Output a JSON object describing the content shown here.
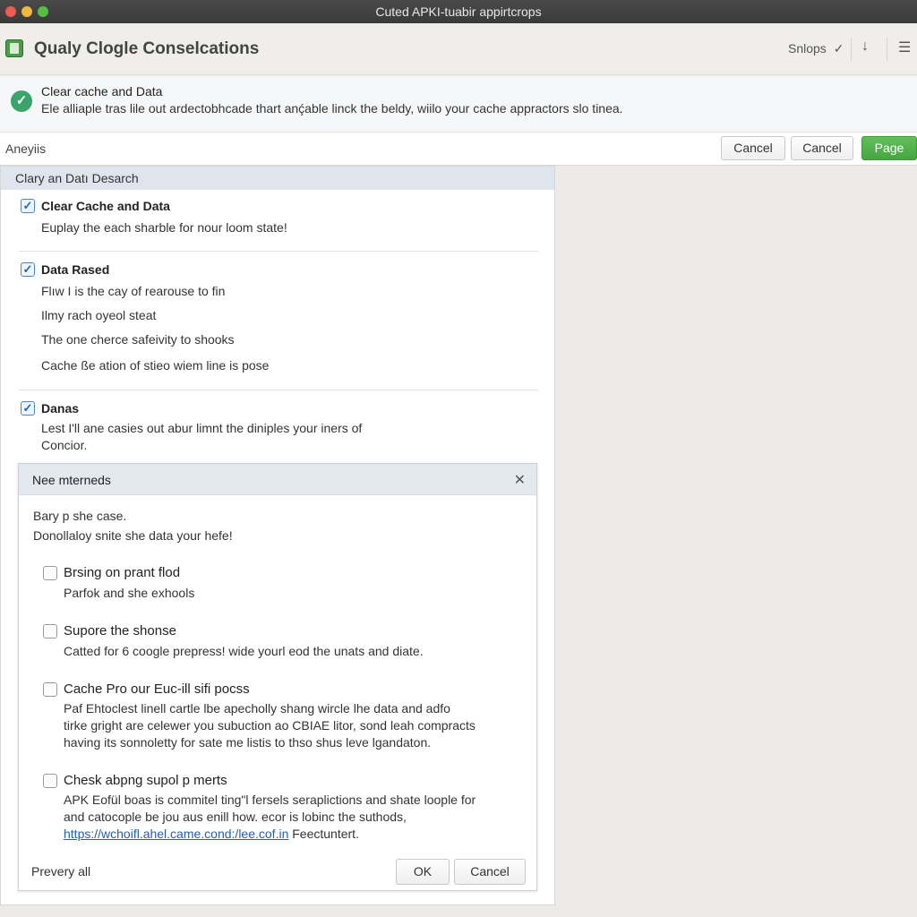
{
  "window": {
    "title": "Cuted APKI-tuabir appirtcrops"
  },
  "header": {
    "title": "Qualy Clogle Conselcations",
    "snops_label": "Snlops",
    "icons": [
      "app-icon",
      "chevron-check-icon",
      "download-icon",
      "menu-icon"
    ]
  },
  "banner": {
    "title": "Clear cache and Data",
    "text": "Ele alliaple tras lile out ardectobhcade thart anḉable linck the beldy, wiilo your cache appractors slo tinea."
  },
  "toolbar": {
    "label": "Aneyiis",
    "cancel1": "Cancel",
    "cancel2": "Cancel",
    "page": "Page"
  },
  "panel": {
    "title": "Clary an Datı Desarch",
    "items": [
      {
        "title": "Clear Cache and Data",
        "checked": true,
        "lines": [
          "Euplay the each sharble for nour loom state!"
        ]
      },
      {
        "title": "Data Rased",
        "checked": true,
        "lines": [
          "Flıw I is the cay of rearouse to fin",
          "Ilmy rach oyeol steat",
          "The one cherce safeivity to shooks",
          "Cache ße ation of stieo wiem line is pose"
        ]
      },
      {
        "title": "Danas",
        "checked": true,
        "lines": [
          "Lest I'll ane casies out abur limnt the diniples your iners of",
          "Concior."
        ]
      }
    ]
  },
  "dialog": {
    "title": "Nee mterneds",
    "intro1": "Bary p she case.",
    "intro2": "Donollaloy snite she data your hefe!",
    "options": [
      {
        "title": "Brsing on prant flod",
        "checked": false,
        "lines": [
          "Parfok and she exhools"
        ]
      },
      {
        "title": "Supore the shonse",
        "checked": false,
        "lines": [
          "Catted for 6 coogle prepress! wide yourl eod the unats and diate."
        ]
      },
      {
        "title": "Cache Pro our Euc-ill sifi pocss",
        "checked": false,
        "lines": [
          "Paf Ehtoclest linell cartle lbe apecholly shang wircle lhe data and adfo",
          "tirke gright are celewer you subuction ao CBIAE litor, sond leah compracts",
          "having its sonnoletty for sate me listis to thso shus leve lgandaton."
        ]
      },
      {
        "title": "Chesk abpng supol p merts",
        "checked": false,
        "lines": [
          "APK Eofül boas is commitel ting\"l fersels seraplictions and shate loople for",
          "and catocople be jou aus enill how. ecor is lobinc the suthods,"
        ],
        "link": "https://wchoifl.ahel.came.cond:/lee.cof.in",
        "link_suffix": "Feectuntert."
      }
    ],
    "footer_label": "Prevery all",
    "ok": "OK",
    "cancel": "Cancel"
  },
  "colors": {
    "accent_green": "#45a640",
    "check_blue": "#1f66b4",
    "banner_check": "#3aa56b"
  }
}
